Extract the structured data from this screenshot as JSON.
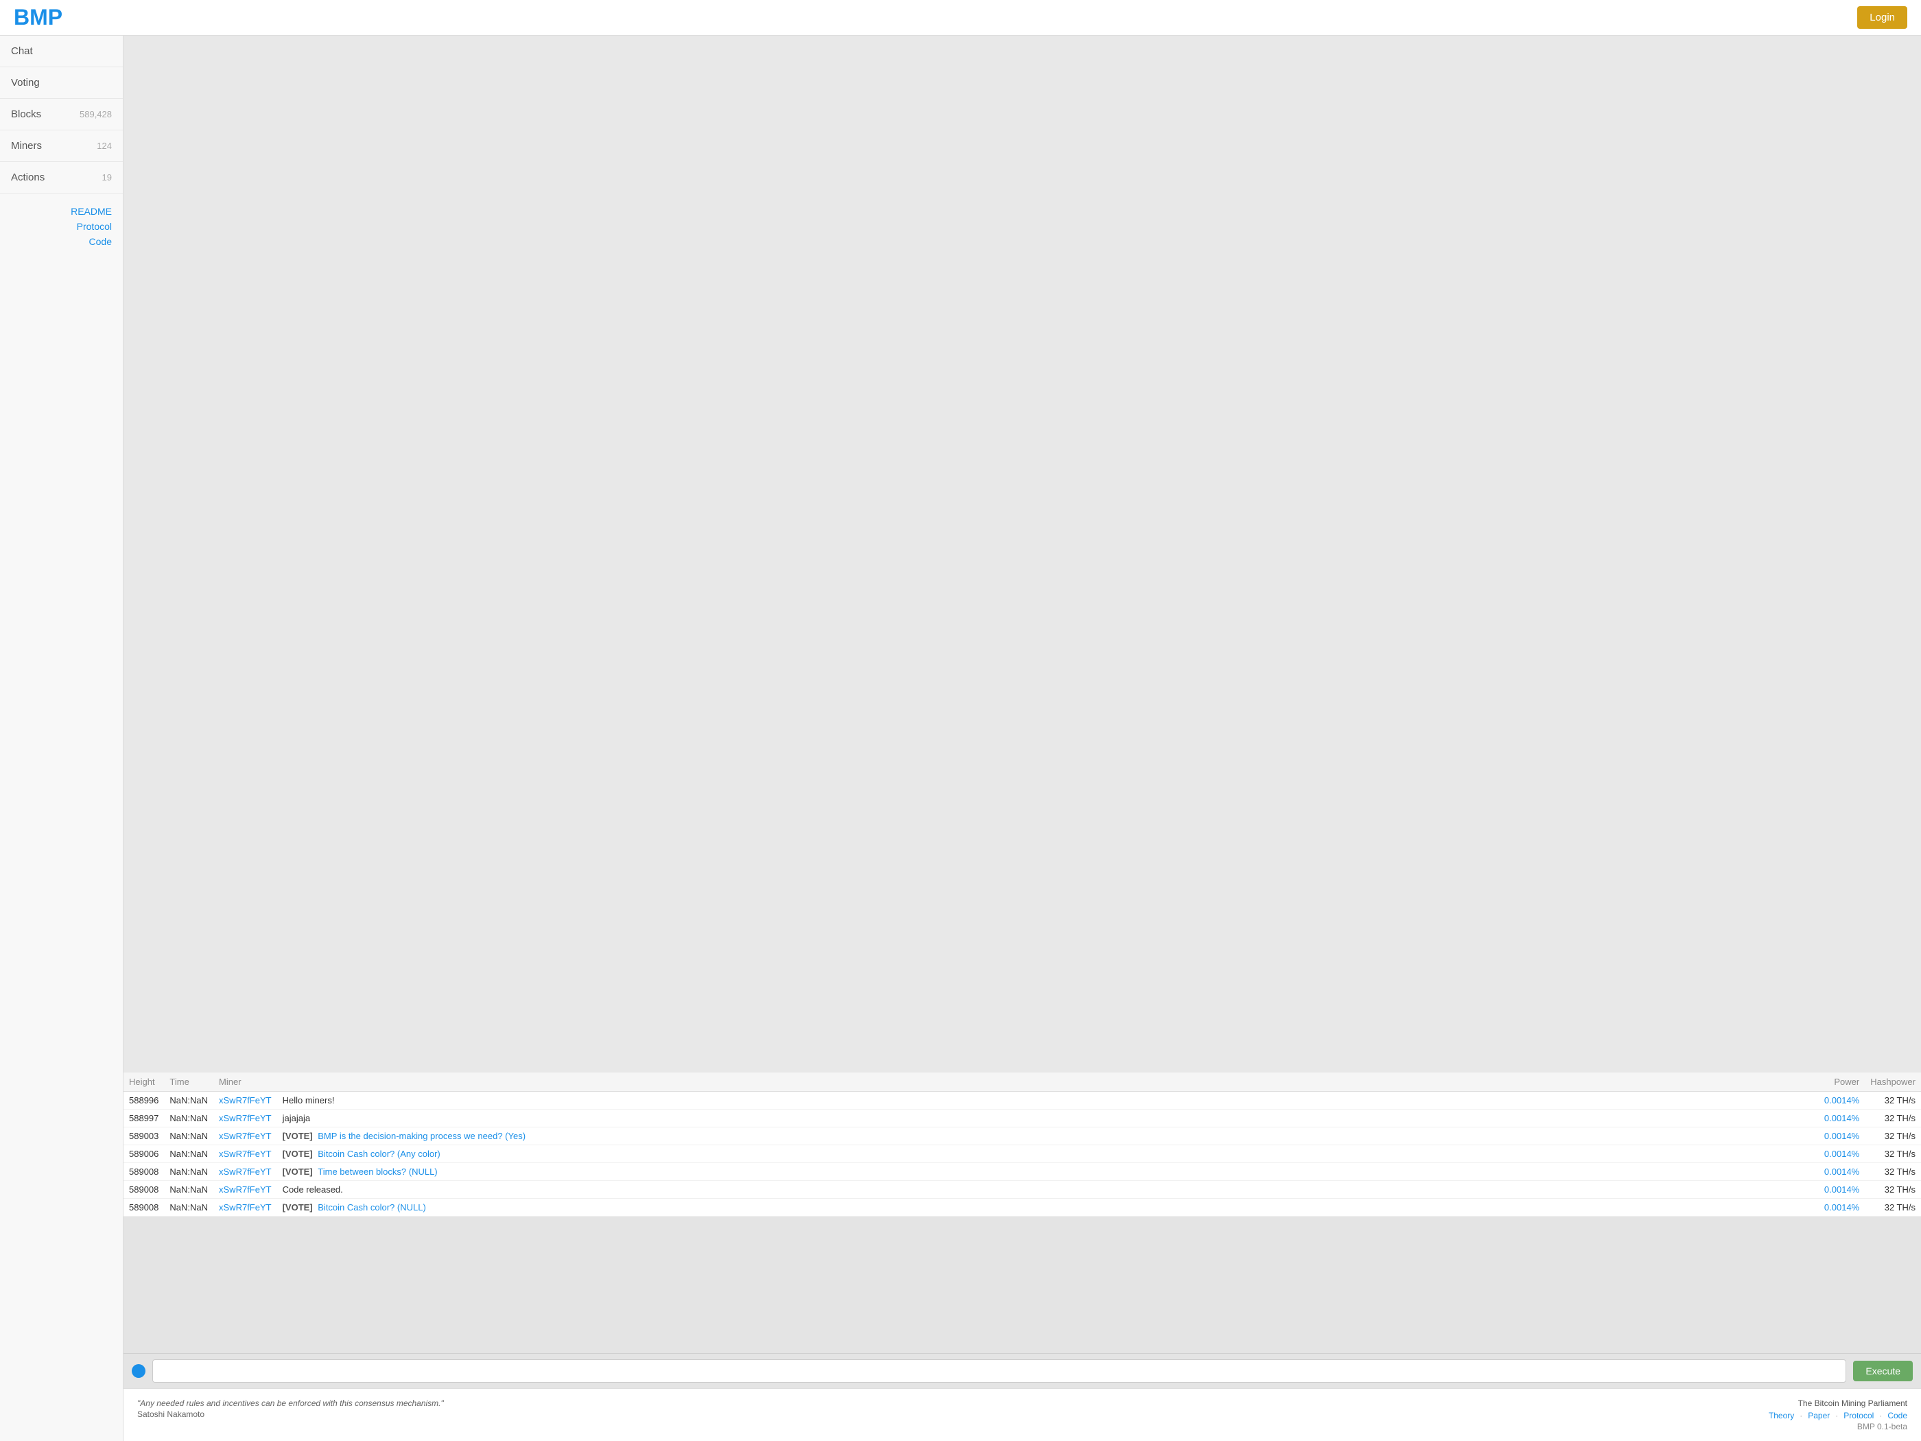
{
  "header": {
    "logo": "BMP",
    "login_label": "Login"
  },
  "sidebar": {
    "items": [
      {
        "label": "Chat",
        "count": null
      },
      {
        "label": "Voting",
        "count": null
      },
      {
        "label": "Blocks",
        "count": "589,428"
      },
      {
        "label": "Miners",
        "count": "124"
      },
      {
        "label": "Actions",
        "count": "19"
      }
    ],
    "links": [
      {
        "label": "README"
      },
      {
        "label": "Protocol"
      },
      {
        "label": "Code"
      }
    ]
  },
  "chat": {
    "columns": {
      "height": "Height",
      "time": "Time",
      "miner": "Miner",
      "message": "",
      "power": "Power",
      "hashpower": "Hashpower"
    },
    "rows": [
      {
        "height": "588996",
        "time": "NaN:NaN",
        "miner": "xSwR7fFeYT",
        "message_type": "text",
        "message": "Hello miners!",
        "power": "0.0014%",
        "hashpower": "32 TH/s"
      },
      {
        "height": "588997",
        "time": "NaN:NaN",
        "miner": "xSwR7fFeYT",
        "message_type": "text",
        "message": "jajajaja",
        "power": "0.0014%",
        "hashpower": "32 TH/s"
      },
      {
        "height": "589003",
        "time": "NaN:NaN",
        "miner": "xSwR7fFeYT",
        "message_type": "vote",
        "vote_label": "[VOTE]",
        "message": "BMP is the decision-making process we need? (Yes)",
        "power": "0.0014%",
        "hashpower": "32 TH/s"
      },
      {
        "height": "589006",
        "time": "NaN:NaN",
        "miner": "xSwR7fFeYT",
        "message_type": "vote",
        "vote_label": "[VOTE]",
        "message": "Bitcoin Cash color? (Any color)",
        "power": "0.0014%",
        "hashpower": "32 TH/s"
      },
      {
        "height": "589008",
        "time": "NaN:NaN",
        "miner": "xSwR7fFeYT",
        "message_type": "vote",
        "vote_label": "[VOTE]",
        "message": "Time between blocks? (NULL)",
        "power": "0.0014%",
        "hashpower": "32 TH/s"
      },
      {
        "height": "589008",
        "time": "NaN:NaN",
        "miner": "xSwR7fFeYT",
        "message_type": "text",
        "message": "Code released.",
        "power": "0.0014%",
        "hashpower": "32 TH/s"
      },
      {
        "height": "589008",
        "time": "NaN:NaN",
        "miner": "xSwR7fFeYT",
        "message_type": "vote",
        "vote_label": "[VOTE]",
        "message": "Bitcoin Cash color? (NULL)",
        "power": "0.0014%",
        "hashpower": "32 TH/s"
      }
    ],
    "input_placeholder": "",
    "execute_label": "Execute"
  },
  "footer": {
    "quote": "\"Any needed rules and incentives can be enforced with this consensus mechanism.\"",
    "author": "Satoshi Nakamoto",
    "title": "The Bitcoin Mining Parliament",
    "links": [
      {
        "label": "Theory"
      },
      {
        "label": "Paper"
      },
      {
        "label": "Protocol"
      },
      {
        "label": "Code"
      }
    ],
    "version": "BMP 0.1-beta"
  }
}
